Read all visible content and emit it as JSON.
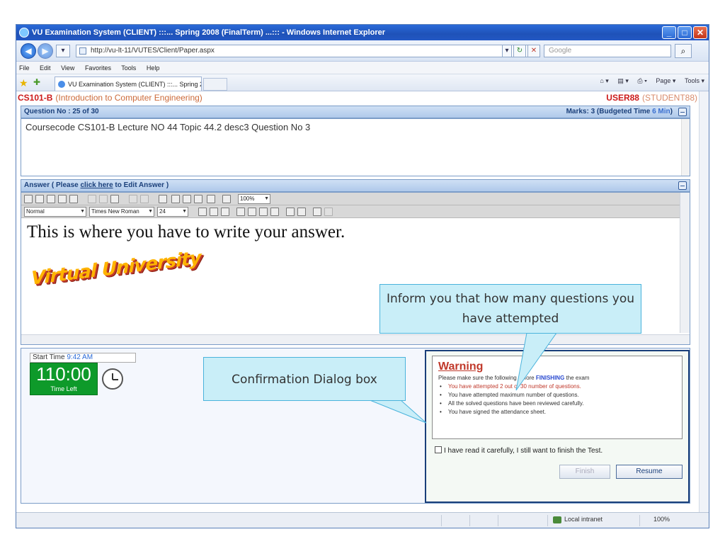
{
  "browser": {
    "window_title": "VU Examination System (CLIENT) :::... Spring 2008 (FinalTerm) ...::: - Windows Internet Explorer",
    "url": "http://vu-lt-11/VUTES/Client/Paper.aspx",
    "search_placeholder": "Google",
    "menu": [
      "File",
      "Edit",
      "View",
      "Favorites",
      "Tools",
      "Help"
    ],
    "tab_label": "VU Examination System (CLIENT) :::... Spring 2008 (F...",
    "toolbar_items": [
      "Page ▾",
      "Tools ▾"
    ],
    "status_zone": "Local intranet",
    "status_zoom": "100%"
  },
  "exam": {
    "course_code": "CS101-B",
    "course_title": "(Introduction to Computer Engineering)",
    "user": "USER88",
    "student": "(STUDENT88)",
    "question_label": "Question No : 25 of 30",
    "marks_text": "Marks: 3 (Budgeted Time ",
    "marks_minutes": "6 Min",
    "marks_close": ")",
    "question_text": "Coursecode CS101-B Lecture NO 44  Topic 44.2 desc3  Question No  3",
    "answer_label_pre": "Answer ( Please ",
    "answer_label_link": "click here",
    "answer_label_post": " to Edit Answer )",
    "editor": {
      "style": "Normal",
      "font": "Times New Roman",
      "size": "24",
      "zoom": "100%"
    },
    "answer_text": "This is where you have to write your answer.",
    "logo_text": "Virtual University",
    "start_time_label": "Start Time ",
    "start_time": "9:42 AM",
    "timer_value": "110:00",
    "timer_label": "Time Left"
  },
  "warning": {
    "title": "Warning",
    "intro_pre": "Please make sure the following before ",
    "intro_hl": "FINISHING",
    "intro_post": " the exam",
    "items": [
      "You have attempted 2 out of 30 number of questions.",
      "You have attempted maximum number of questions.",
      "All the solved questions have been  reviewed carefully.",
      "You have signed the attendance sheet."
    ],
    "confirm_text": "I have read it carefully, I still want to finish the Test.",
    "finish_label": "Finish",
    "resume_label": "Resume"
  },
  "callouts": {
    "attempted": "Inform you that how many questions you have attempted",
    "dialog": "Confirmation  Dialog box"
  },
  "colors": {
    "title_bar": "#1f52b8",
    "course_red": "#cc1a1a",
    "timer_green": "#0e9a2a",
    "warning_red": "#c0392b",
    "callout_fill": "#c9eef8"
  }
}
